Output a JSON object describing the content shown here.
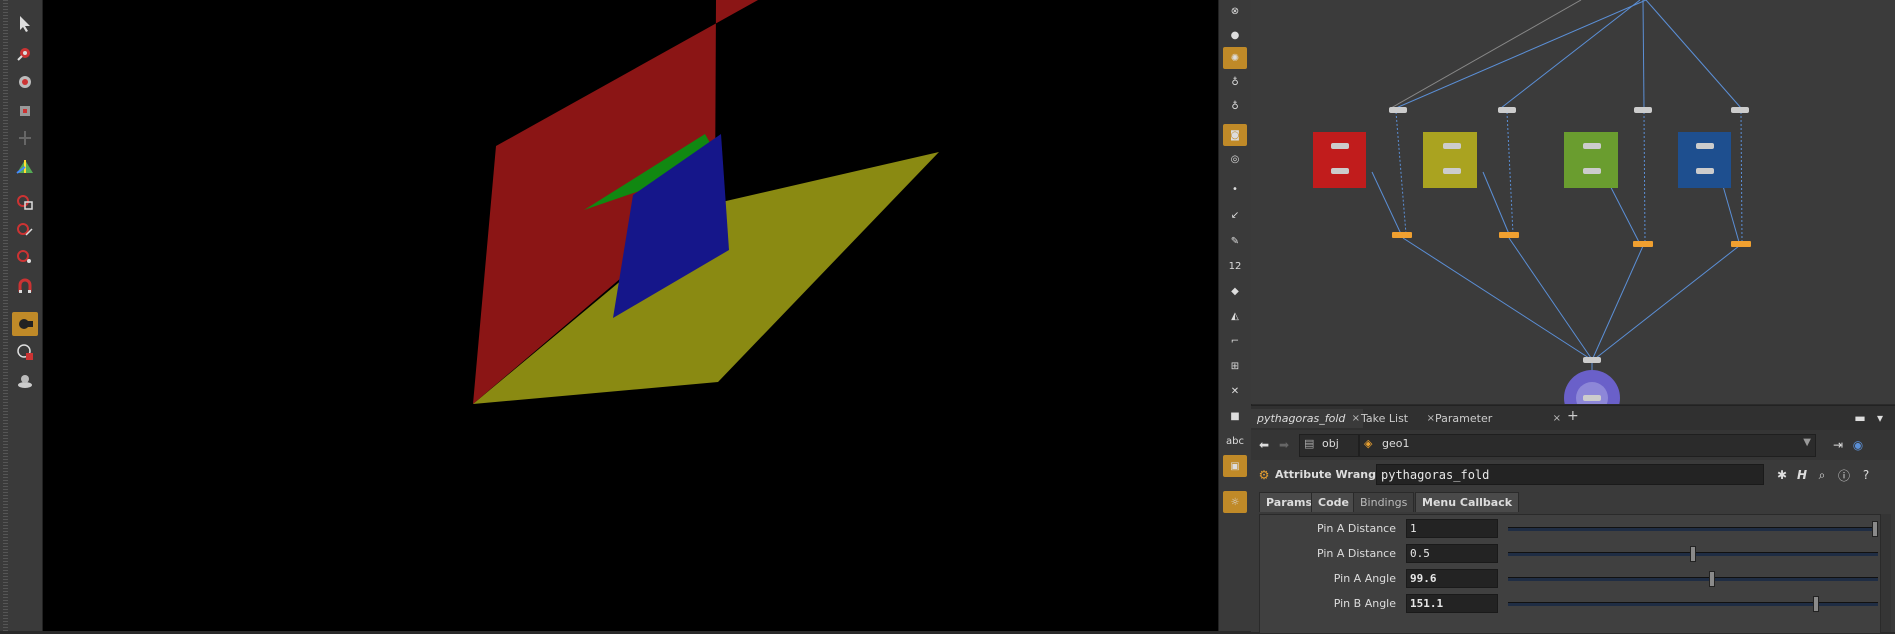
{
  "param_pane": {
    "tabs": [
      {
        "label": "pythagoras_fold",
        "close": "×"
      },
      {
        "label": "Take List",
        "close": "×"
      },
      {
        "label": "Parameter Spreadsheet",
        "close": "×"
      }
    ],
    "add_tab": "+",
    "path": {
      "root": "obj",
      "node": "geo1"
    },
    "operator": {
      "type_label": "Attribute Wrangle",
      "name": "pythagoras_fold",
      "help_letter": "H"
    },
    "sub_tabs": [
      "Params",
      "Code",
      "Bindings",
      "Menu Callback"
    ],
    "parameters": [
      {
        "label": "Pin A Distance",
        "value": "1",
        "fraction": 1.0
      },
      {
        "label": "Pin A Distance",
        "value": "0.5",
        "fraction": 0.5
      },
      {
        "label": "Pin A Angle",
        "value": "99.6",
        "fraction": 0.553
      },
      {
        "label": "Pin B Angle",
        "value": "151.1",
        "fraction": 0.839
      }
    ]
  },
  "right_toolbar": {
    "abc_label": "abc",
    "number_label": "12"
  },
  "colors": {
    "red_plane": "#8b1515",
    "yellow_plane": "#8a8a12",
    "green_plane": "#118811",
    "blue_plane": "#15168a",
    "accent": "#c08a28"
  },
  "icons": {
    "left_toolbar": [
      "select-icon",
      "transform-icon",
      "rotate-icon",
      "scale-icon",
      "handle-icon",
      "pose-icon",
      "camera-icon",
      "snap-icon",
      "snap-grid-icon",
      "snap-point-icon",
      "magnet-icon",
      "render-icon",
      "flipbook-icon",
      "display-icon"
    ],
    "right_toolbar": [
      "close-icon",
      "sphere-icon",
      "light-icon",
      "point-light-icon",
      "spot-light-icon",
      "camera-icon",
      "eye-icon",
      "dot-icon",
      "pen-icon",
      "brush-icon",
      "number-icon",
      "bucket-icon",
      "fill-icon",
      "curve-icon",
      "transform-icon",
      "skeleton-icon",
      "stop-icon",
      "abc-icon",
      "image-icon",
      "bulb-icon"
    ]
  }
}
